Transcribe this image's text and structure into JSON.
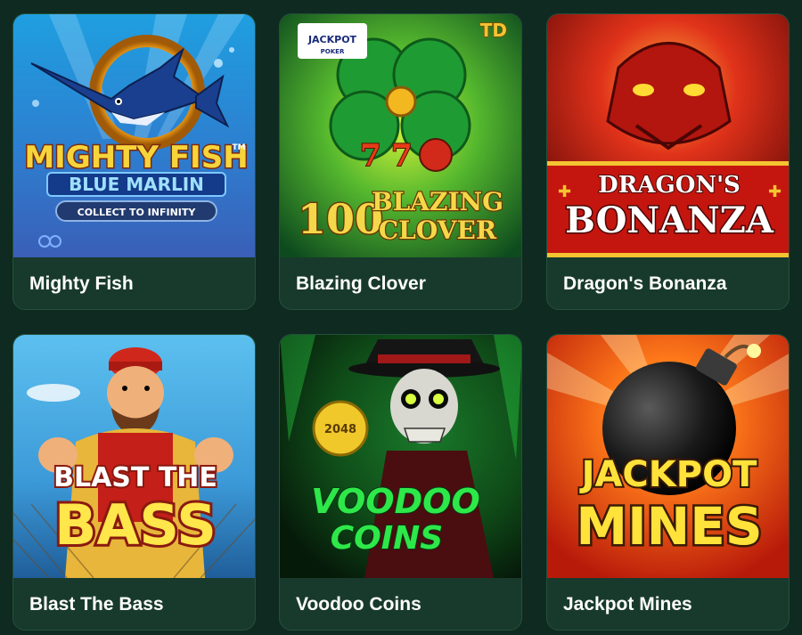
{
  "games": [
    {
      "title": "Mighty Fish",
      "logo_line1": "MIGHTY FISH",
      "logo_tm": "TM",
      "logo_line2": "BLUE MARLIN",
      "logo_line3": "COLLECT TO INFINITY",
      "icon": "marlin-fish-icon"
    },
    {
      "title": "Blazing Clover",
      "badge": "TD",
      "jackpot_label": "JACKPOT",
      "jackpot_sub": "POKER",
      "logo_number": "100",
      "logo_line1": "BLAZING",
      "logo_line2": "CLOVER",
      "icon": "four-leaf-clover-icon"
    },
    {
      "title": "Dragon's Bonanza",
      "logo_line1": "DRAGON'S",
      "logo_line2": "BONANZA",
      "icon": "dragon-head-icon"
    },
    {
      "title": "Blast The Bass",
      "logo_line1": "BLAST THE",
      "logo_line2": "BASS",
      "icon": "fisherman-icon"
    },
    {
      "title": "Voodoo Coins",
      "coin_value": "2048",
      "logo_line1": "VOODOO",
      "logo_line2": "COINS",
      "icon": "skeleton-icon"
    },
    {
      "title": "Jackpot Mines",
      "logo_line1": "JACKPOT",
      "logo_line2": "MINES",
      "icon": "bomb-icon"
    }
  ],
  "colors": {
    "page_bg": "#0f2a20",
    "card_bg": "#183a2c",
    "title_text": "#ffffff"
  }
}
